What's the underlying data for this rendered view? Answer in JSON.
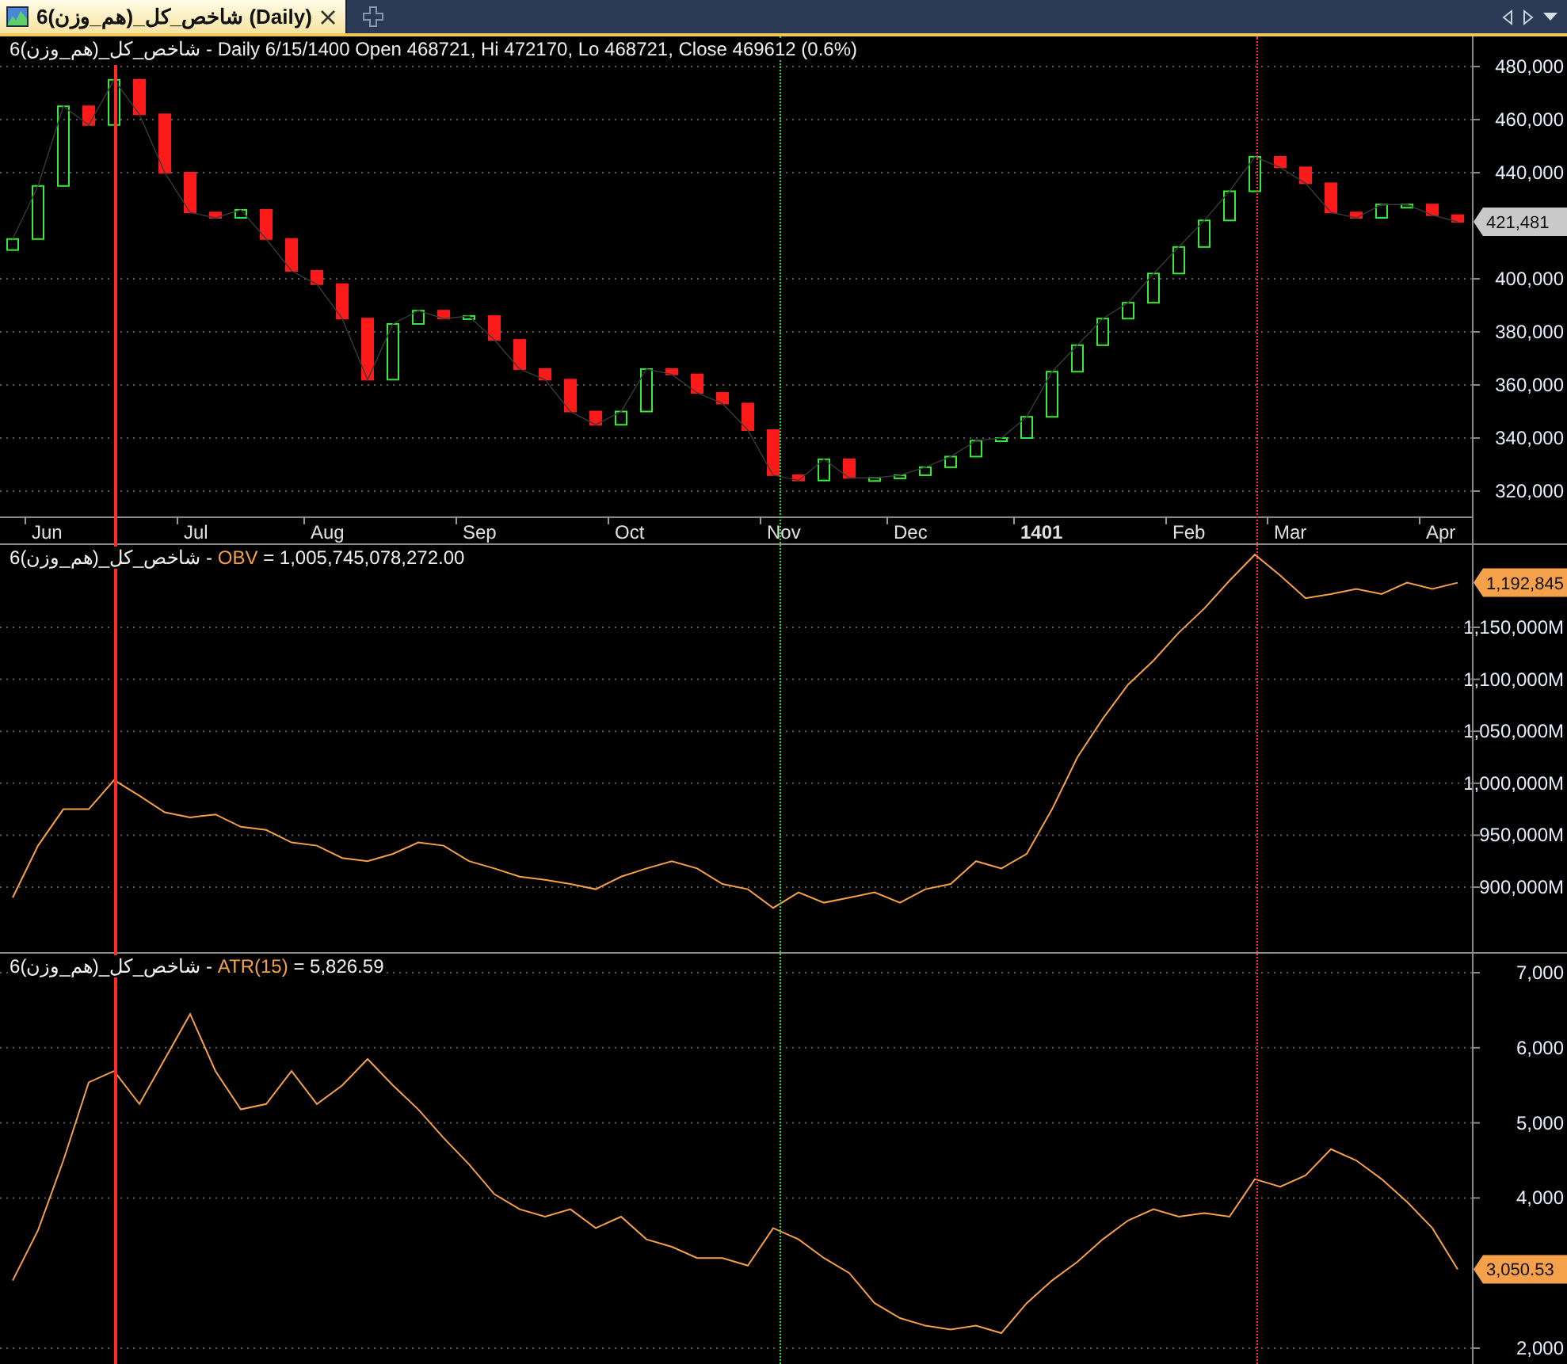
{
  "tab": {
    "title": "شاخص_کل_(هم_وزن)6 (Daily)",
    "selected": true
  },
  "panels": [
    {
      "legend": {
        "text": "شاخص_کل_(هم_وزن)6 - Daily 6/15/1400 Open 468721, Hi 472170, Lo 468721, Close 469612 (0.6%)"
      },
      "kind": "price",
      "last_value": "421,481",
      "chart_data": {
        "type": "line",
        "grid": true,
        "ylim": [
          310450,
          491350
        ],
        "categories": [
          null,
          "Jun",
          null,
          null,
          null,
          null,
          null,
          "Jul",
          null,
          null,
          null,
          null,
          "Aug",
          null,
          null,
          null,
          null,
          null,
          "Sep",
          null,
          null,
          null,
          null,
          null,
          "Oct",
          null,
          null,
          null,
          null,
          null,
          "Nov",
          null,
          null,
          null,
          null,
          "Dec",
          null,
          null,
          null,
          null,
          "1401",
          null,
          null,
          null,
          null,
          null,
          "Feb",
          null,
          null,
          null,
          "Mar",
          null,
          null,
          null,
          null,
          null,
          "Apr",
          null
        ],
        "yticks": [
          {
            "value": 480000,
            "label": "480,000"
          },
          {
            "value": 460000,
            "label": "460,000"
          },
          {
            "value": 440000,
            "label": "440,000"
          },
          {
            "value": 400000,
            "label": "400,000"
          },
          {
            "value": 380000,
            "label": "380,000"
          },
          {
            "value": 360000,
            "label": "360,000"
          },
          {
            "value": 340000,
            "label": "340,000"
          },
          {
            "value": 320000,
            "label": "320,000"
          }
        ],
        "series": [
          {
            "values": [
              415000,
              435000,
              465000,
              458000,
              475000,
              462000,
              440000,
              425000,
              423000,
              426000,
              415000,
              403000,
              398000,
              385000,
              362000,
              383000,
              388000,
              385000,
              386000,
              377000,
              366000,
              362000,
              350000,
              345000,
              350000,
              366000,
              364000,
              357000,
              353000,
              343000,
              326000,
              324000,
              332000,
              325000,
              325000,
              326000,
              329000,
              333000,
              339000,
              340000,
              348000,
              365000,
              375000,
              385000,
              391000,
              402000,
              412000,
              422000,
              433000,
              446000,
              442000,
              436000,
              425000,
              423000,
              428000,
              428000,
              424000,
              421500
            ]
          }
        ]
      }
    },
    {
      "legend": {
        "symbol": "شاخص_کل_(هم_وزن)6 -",
        "value": "= 1,005,745,078,272.00"
      },
      "kind": "indicator",
      "last_value": "1,192,845",
      "chart_data": {
        "type": "line",
        "grid": true,
        "ylim": [
          837500,
          1229250
        ],
        "yticks": [
          {
            "value": 1150000,
            "label": "1,150,000M"
          },
          {
            "value": 1100000,
            "label": "1,100,000M"
          },
          {
            "value": 1050000,
            "label": "1,050,000M"
          },
          {
            "value": 1000000,
            "label": "1,000,000M"
          },
          {
            "value": 950000,
            "label": "950,000M"
          },
          {
            "value": 900000,
            "label": "900,000M"
          }
        ],
        "series": [
          {
            "name": "OBV",
            "color": "#f5a04a",
            "values": [
              890000,
              940000,
              975000,
              975000,
              1003000,
              988000,
              972000,
              967000,
              970000,
              958000,
              955000,
              943000,
              940000,
              928000,
              925000,
              932000,
              943000,
              940000,
              925000,
              918000,
              910000,
              907000,
              903000,
              898000,
              910000,
              918000,
              925000,
              918000,
              903000,
              898000,
              880000,
              895000,
              885000,
              890000,
              895000,
              885000,
              898000,
              903000,
              925000,
              918000,
              932000,
              975000,
              1025000,
              1062000,
              1095000,
              1118000,
              1145000,
              1168000,
              1195000,
              1220000,
              1200000,
              1178000,
              1182000,
              1187000,
              1182000,
              1193000,
              1187000,
              1193000
            ]
          }
        ]
      }
    },
    {
      "legend": {
        "symbol": "شاخص_کل_(هم_وزن)6 -",
        "value": "= 5,826.59"
      },
      "kind": "indicator",
      "last_value": "3,050.53",
      "chart_data": {
        "type": "line",
        "grid": true,
        "ylim": [
          1768,
          7253
        ],
        "yticks": [
          {
            "value": 7000,
            "label": "7,000"
          },
          {
            "value": 6000,
            "label": "6,000"
          },
          {
            "value": 5000,
            "label": "5,000"
          },
          {
            "value": 4000,
            "label": "4,000"
          },
          {
            "value": 2000,
            "label": "2,000"
          }
        ],
        "series": [
          {
            "name": "ATR(15)",
            "color": "#f5a04a",
            "values": [
              2900,
              3570,
              4500,
              5540,
              5690,
              5250,
              5850,
              6450,
              5690,
              5180,
              5250,
              5690,
              5250,
              5500,
              5850,
              5500,
              5180,
              4800,
              4450,
              4050,
              3850,
              3750,
              3850,
              3600,
              3750,
              3450,
              3350,
              3200,
              3200,
              3100,
              3600,
              3450,
              3200,
              3000,
              2600,
              2400,
              2300,
              2250,
              2300,
              2200,
              2600,
              2900,
              3150,
              3450,
              3700,
              3850,
              3750,
              3800,
              3750,
              4250,
              4150,
              4300,
              4650,
              4500,
              4250,
              3950,
              3600,
              3050
            ]
          }
        ]
      }
    }
  ]
}
